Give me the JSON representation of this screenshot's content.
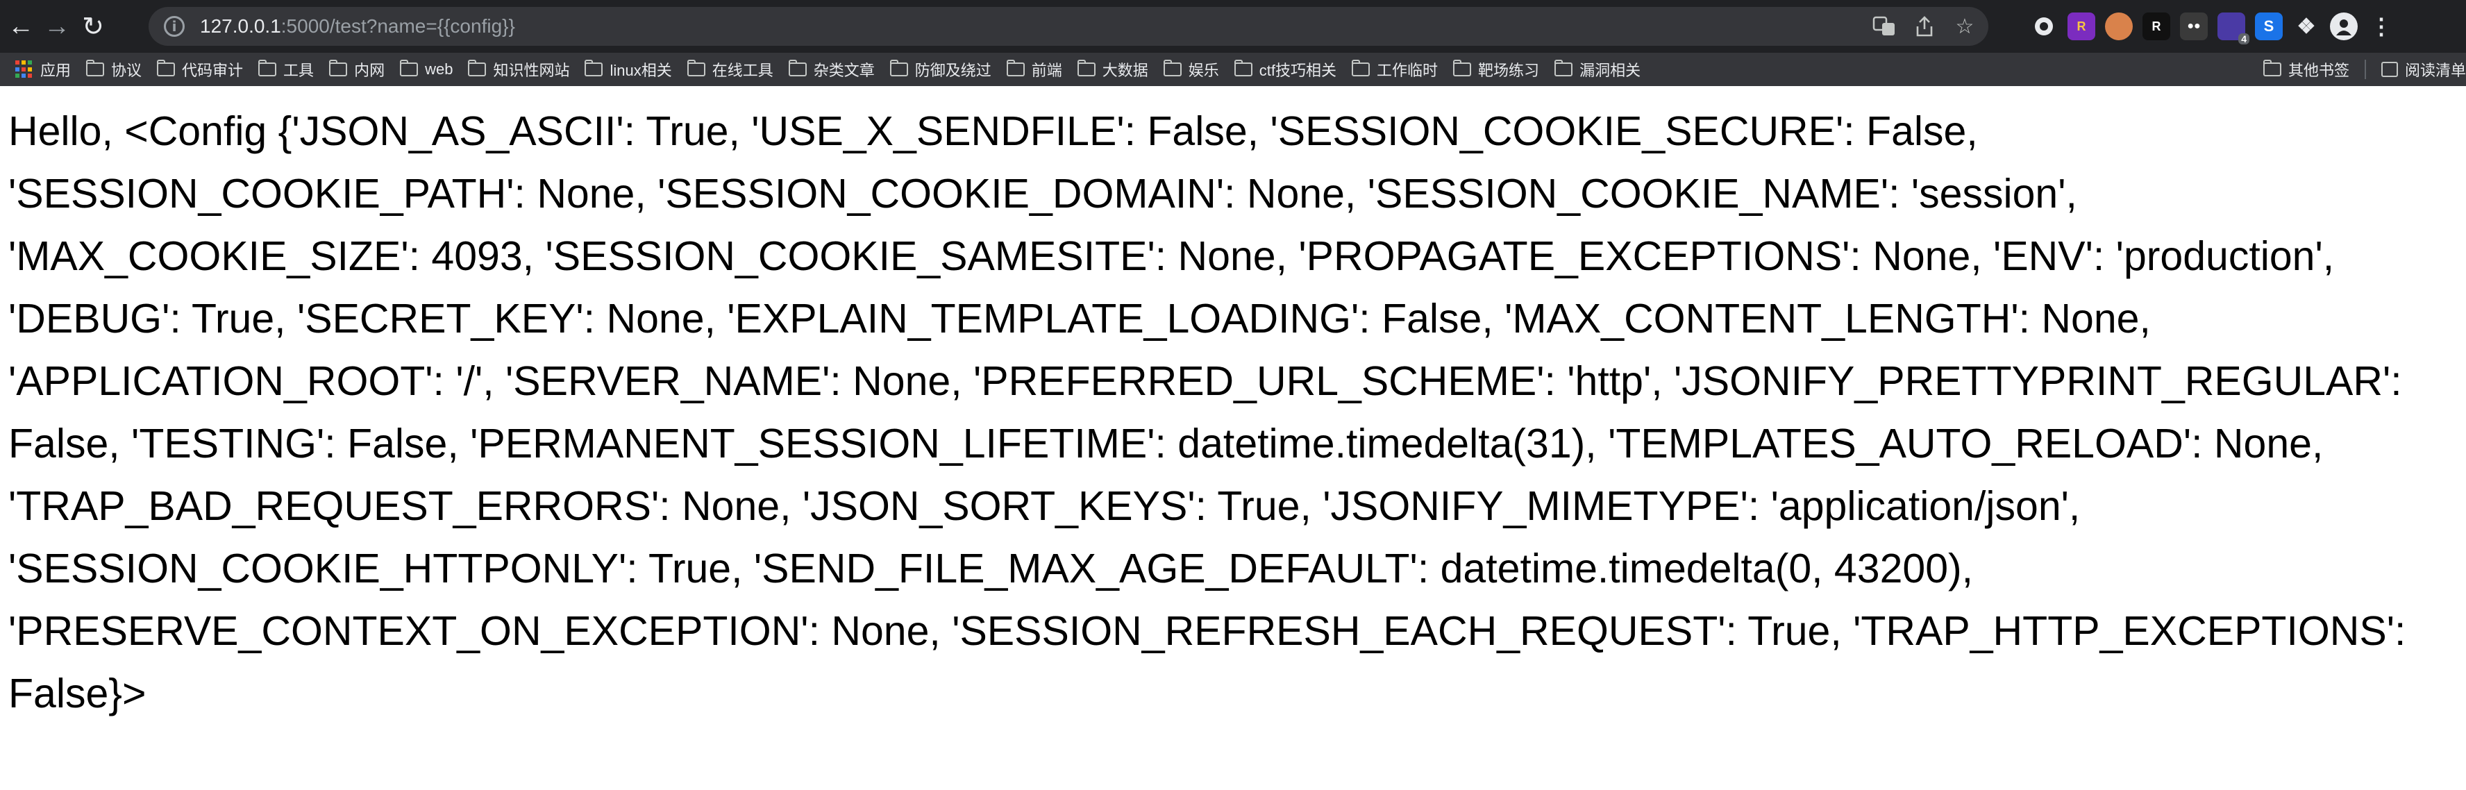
{
  "browser": {
    "url_host": "127.0.0.1",
    "url_rest": ":5000/test?name={{config}}",
    "extension_badge": "4",
    "icons": [
      "back-icon",
      "forward-icon",
      "reload-icon",
      "info-icon",
      "translate-icon",
      "share-icon",
      "star-icon",
      "extensions-puzzle-icon",
      "profile-icon",
      "menu-icon"
    ]
  },
  "bookmarks": {
    "apps_label": "应用",
    "items": [
      "协议",
      "代码审计",
      "工具",
      "内网",
      "web",
      "知识性网站",
      "linux相关",
      "在线工具",
      "杂类文章",
      "防御及绕过",
      "前端",
      "大数据",
      "娱乐",
      "ctf技巧相关",
      "工作临时",
      "靶场练习",
      "漏洞相关"
    ],
    "other_label": "其他书签",
    "reading_list_label": "阅读清单"
  },
  "page": {
    "content_text": "Hello, <Config {'JSON_AS_ASCII': True, 'USE_X_SENDFILE': False, 'SESSION_COOKIE_SECURE': False, 'SESSION_COOKIE_PATH': None, 'SESSION_COOKIE_DOMAIN': None, 'SESSION_COOKIE_NAME': 'session', 'MAX_COOKIE_SIZE': 4093, 'SESSION_COOKIE_SAMESITE': None, 'PROPAGATE_EXCEPTIONS': None, 'ENV': 'production', 'DEBUG': True, 'SECRET_KEY': None, 'EXPLAIN_TEMPLATE_LOADING': False, 'MAX_CONTENT_LENGTH': None, 'APPLICATION_ROOT': '/', 'SERVER_NAME': None, 'PREFERRED_URL_SCHEME': 'http', 'JSONIFY_PRETTYPRINT_REGULAR': False, 'TESTING': False, 'PERMANENT_SESSION_LIFETIME': datetime.timedelta(31), 'TEMPLATES_AUTO_RELOAD': None, 'TRAP_BAD_REQUEST_ERRORS': None, 'JSON_SORT_KEYS': True, 'JSONIFY_MIMETYPE': 'application/json', 'SESSION_COOKIE_HTTPONLY': True, 'SEND_FILE_MAX_AGE_DEFAULT': datetime.timedelta(0, 43200), 'PRESERVE_CONTEXT_ON_EXCEPTION': None, 'SESSION_REFRESH_EACH_REQUEST': True, 'TRAP_HTTP_EXCEPTIONS': False}>"
  },
  "colors": {
    "toolbar_bg": "#202124",
    "omnibox_bg": "#35363a",
    "page_bg": "#ffffff",
    "text": "#000000"
  }
}
